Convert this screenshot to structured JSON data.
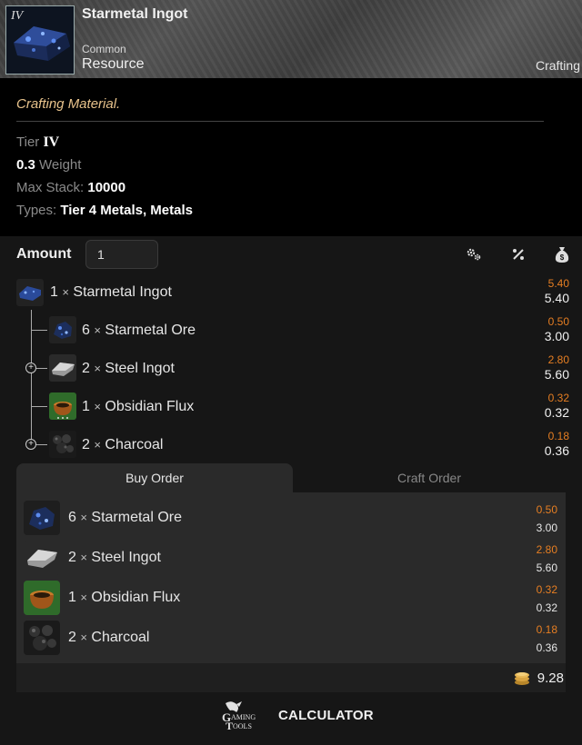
{
  "header": {
    "tier_badge": "IV",
    "title": "Starmetal Ingot",
    "rarity": "Common",
    "item_type": "Resource",
    "category": "Crafting"
  },
  "info": {
    "description": "Crafting Material.",
    "tier_label": "Tier",
    "tier_value": "IV",
    "weight_value": "0.3",
    "weight_label": "Weight",
    "max_stack_label": "Max Stack:",
    "max_stack_value": "10000",
    "types_label": "Types:",
    "types_value": "Tier 4 Metals, Metals"
  },
  "calculator": {
    "amount_label": "Amount",
    "amount_value": "1",
    "tools": [
      "settings-icon",
      "percent-icon",
      "money-bag-icon"
    ],
    "tree": [
      {
        "qty": "1",
        "times": "×",
        "name": "Starmetal Ingot",
        "unit_price": "5.40",
        "total": "5.40",
        "icon": "starmetal-ingot"
      },
      {
        "qty": "6",
        "times": "×",
        "name": "Starmetal Ore",
        "unit_price": "0.50",
        "total": "3.00",
        "icon": "starmetal-ore"
      },
      {
        "qty": "2",
        "times": "×",
        "name": "Steel Ingot",
        "unit_price": "2.80",
        "total": "5.60",
        "icon": "steel-ingot"
      },
      {
        "qty": "1",
        "times": "×",
        "name": "Obsidian Flux",
        "unit_price": "0.32",
        "total": "0.32",
        "icon": "obsidian-flux"
      },
      {
        "qty": "2",
        "times": "×",
        "name": "Charcoal",
        "unit_price": "0.18",
        "total": "0.36",
        "icon": "charcoal"
      }
    ]
  },
  "orders": {
    "tabs": [
      "Buy Order",
      "Craft Order"
    ],
    "active_tab": "Buy Order",
    "items": [
      {
        "qty": "6",
        "times": "×",
        "name": "Starmetal Ore",
        "unit_price": "0.50",
        "total": "3.00",
        "icon": "starmetal-ore"
      },
      {
        "qty": "2",
        "times": "×",
        "name": "Steel Ingot",
        "unit_price": "2.80",
        "total": "5.60",
        "icon": "steel-ingot"
      },
      {
        "qty": "1",
        "times": "×",
        "name": "Obsidian Flux",
        "unit_price": "0.32",
        "total": "0.32",
        "icon": "obsidian-flux"
      },
      {
        "qty": "2",
        "times": "×",
        "name": "Charcoal",
        "unit_price": "0.18",
        "total": "0.36",
        "icon": "charcoal"
      }
    ],
    "total": "9.28"
  },
  "footer": {
    "brand": "CALCULATOR",
    "logo_text_top": "AMING",
    "logo_text_bottom": "OOLS"
  },
  "colors": {
    "accent_orange": "#e67e22",
    "description_gold": "#e8c38c",
    "panel_bg": "#2a2a2a",
    "page_bg": "#161616"
  }
}
